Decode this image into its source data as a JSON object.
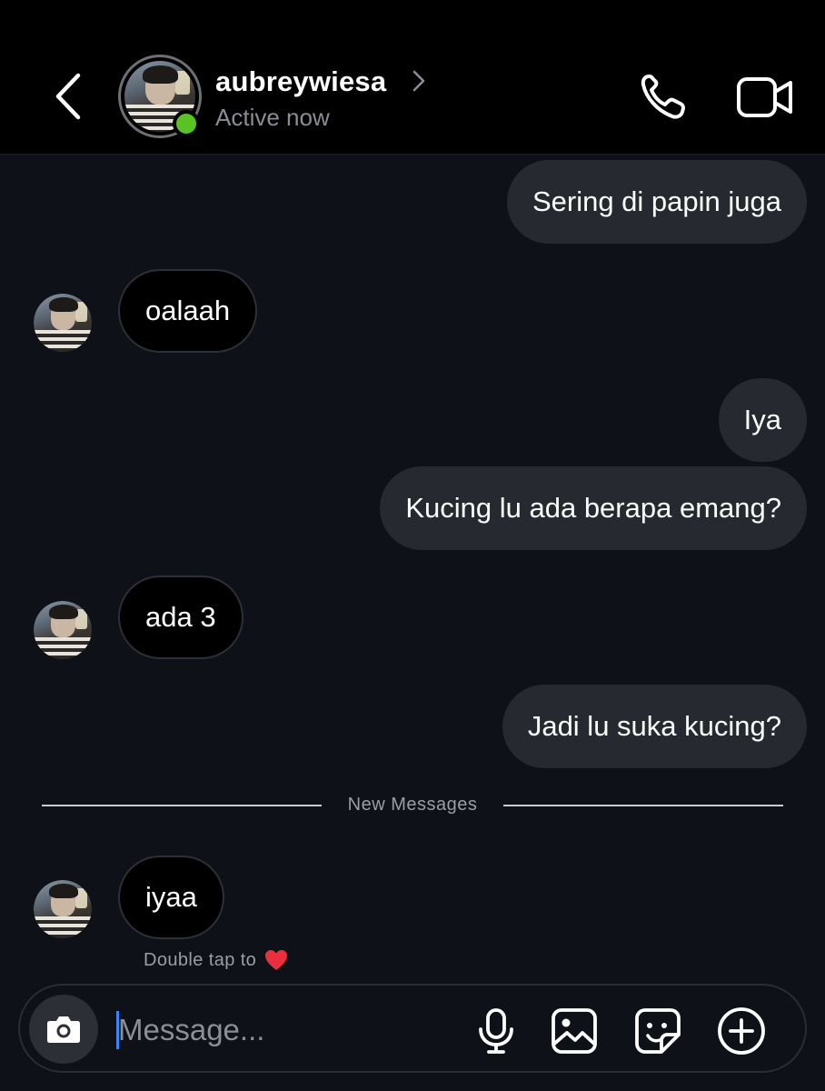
{
  "header": {
    "username": "aubreywiesa",
    "status": "Active now",
    "icons": [
      "back-arrow-icon",
      "chevron-right-icon",
      "phone-icon",
      "video-camera-icon"
    ],
    "online_color": "#58c322"
  },
  "messages": [
    {
      "direction": "outgoing",
      "text": "Sering di papin juga"
    },
    {
      "direction": "incoming",
      "text": "oalaah"
    },
    {
      "direction": "outgoing",
      "text": "Iya"
    },
    {
      "direction": "outgoing",
      "text": "Kucing lu ada berapa emang?"
    },
    {
      "direction": "incoming",
      "text": "ada 3"
    },
    {
      "direction": "outgoing",
      "text": "Jadi lu suka kucing?"
    },
    {
      "direction": "incoming",
      "text": "iyaa"
    }
  ],
  "divider": {
    "label": "New Messages"
  },
  "hint": {
    "text": "Double tap to",
    "icon": "heart-icon",
    "heart_color": "#e8303f"
  },
  "composer": {
    "placeholder": "Message...",
    "value": "",
    "icons": [
      "camera-icon",
      "microphone-icon",
      "gallery-icon",
      "sticker-icon",
      "plus-icon"
    ],
    "cursor_color": "#3a86ff"
  },
  "colors": {
    "background": "#0e1117",
    "header_background": "#000000",
    "outgoing_bubble": "#262a30",
    "incoming_bubble": "#000000"
  }
}
